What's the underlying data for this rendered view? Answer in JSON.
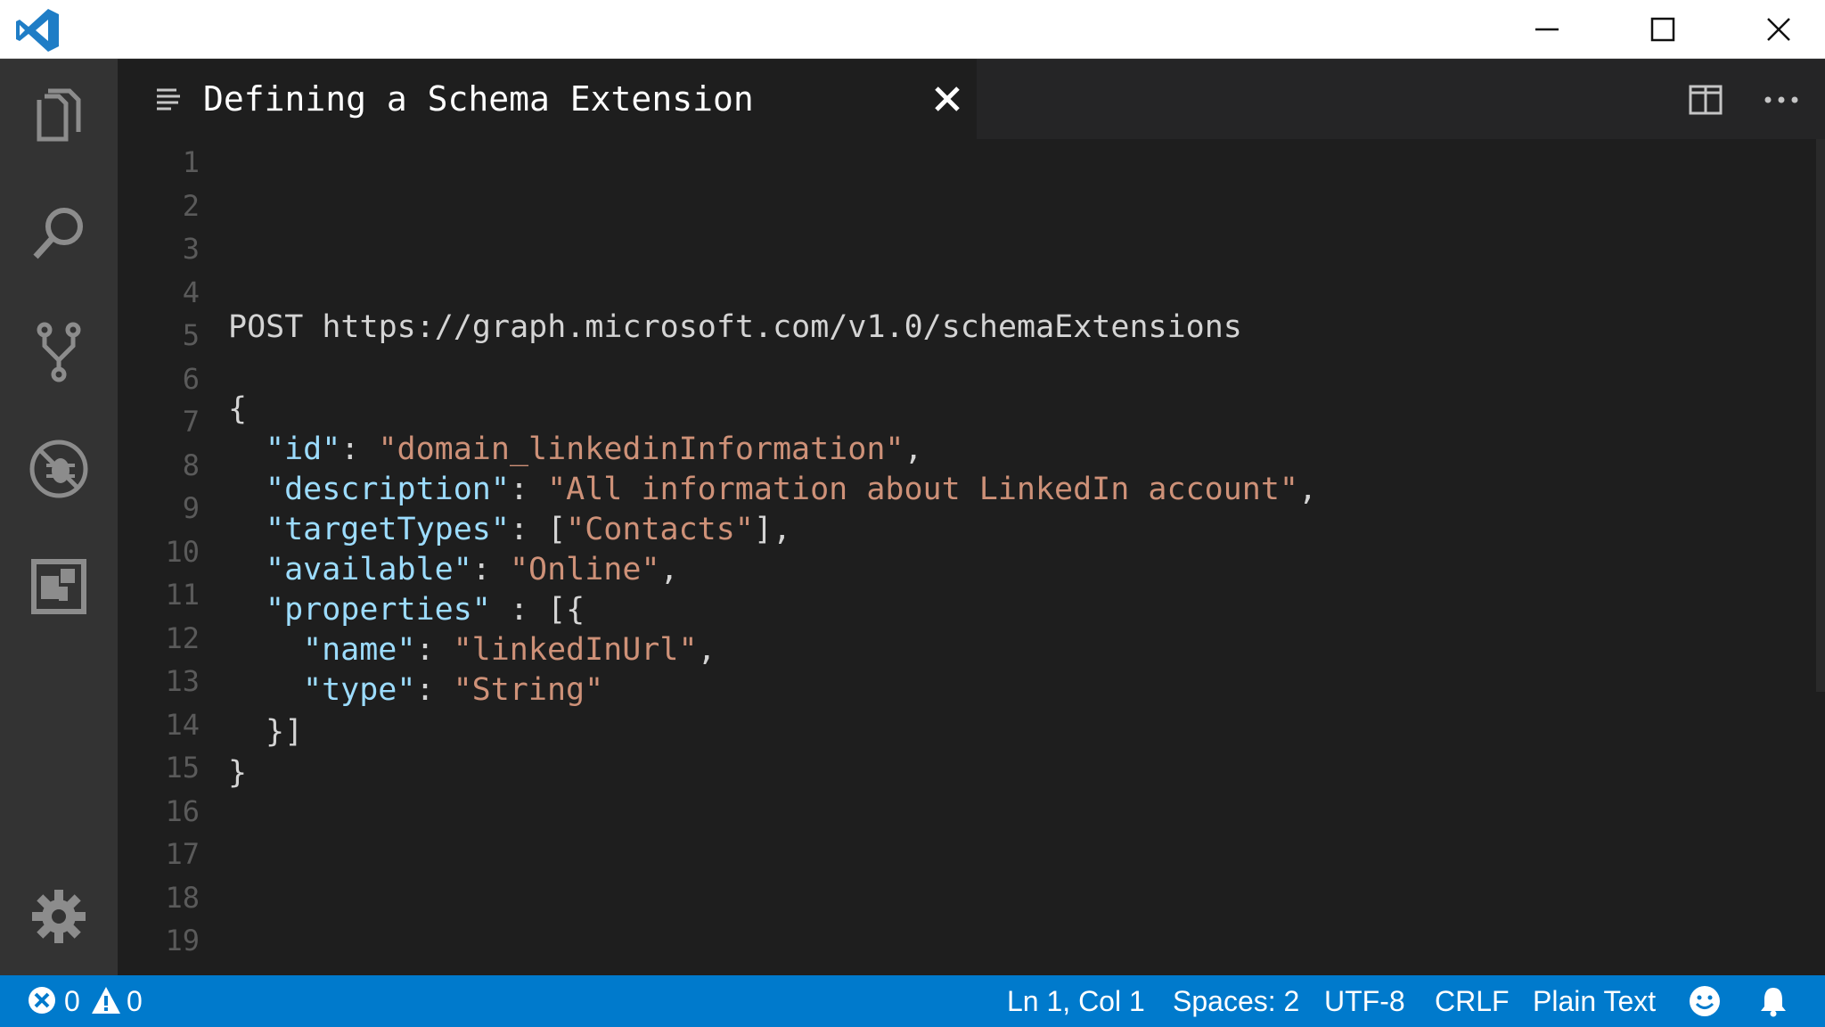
{
  "window": {
    "controls": [
      "minimize",
      "maximize",
      "close"
    ],
    "accent": "#007acc"
  },
  "activity_bar": {
    "items": [
      "explorer-icon",
      "search-icon",
      "source-control-icon",
      "debug-icon",
      "extensions-icon"
    ],
    "settings_icon": "gear-icon"
  },
  "tab": {
    "title": "Defining a Schema Extension"
  },
  "editor": {
    "line_numbers": [
      "1",
      "2",
      "3",
      "4",
      "5",
      "6",
      "7",
      "8",
      "9",
      "10",
      "11",
      "12",
      "13",
      "14",
      "15",
      "16",
      "17",
      "18",
      "19"
    ],
    "lines": [
      {
        "n": 5,
        "text": "POST https://graph.microsoft.com/v1.0/schemaExtensions"
      },
      {
        "n": 7,
        "text": "{"
      },
      {
        "n": 8,
        "key": "\"id\"",
        "sep": ": ",
        "value": "\"domain_linkedinInformation\"",
        "tail": ","
      },
      {
        "n": 9,
        "key": "\"description\"",
        "sep": ": ",
        "value": "\"All information about LinkedIn account\"",
        "tail": ","
      },
      {
        "n": 10,
        "key": "\"targetTypes\"",
        "sep": ": [",
        "value": "\"Contacts\"",
        "tail": "],"
      },
      {
        "n": 11,
        "key": "\"available\"",
        "sep": ": ",
        "value": "\"Online\"",
        "tail": ","
      },
      {
        "n": 12,
        "key": "\"properties\"",
        "sep": " : [{",
        "value": "",
        "tail": ""
      },
      {
        "n": 13,
        "key": "\"name\"",
        "sep": ": ",
        "value": "\"linkedInUrl\"",
        "tail": ","
      },
      {
        "n": 14,
        "key": "\"type\"",
        "sep": ": ",
        "value": "\"String\"",
        "tail": ""
      },
      {
        "n": 15,
        "text": "}]"
      },
      {
        "n": 16,
        "text": "}"
      }
    ]
  },
  "status_bar": {
    "errors": "0",
    "warnings": "0",
    "cursor": "Ln 1, Col 1",
    "spaces": "Spaces: 2",
    "encoding": "UTF-8",
    "eol": "CRLF",
    "language": "Plain Text"
  }
}
